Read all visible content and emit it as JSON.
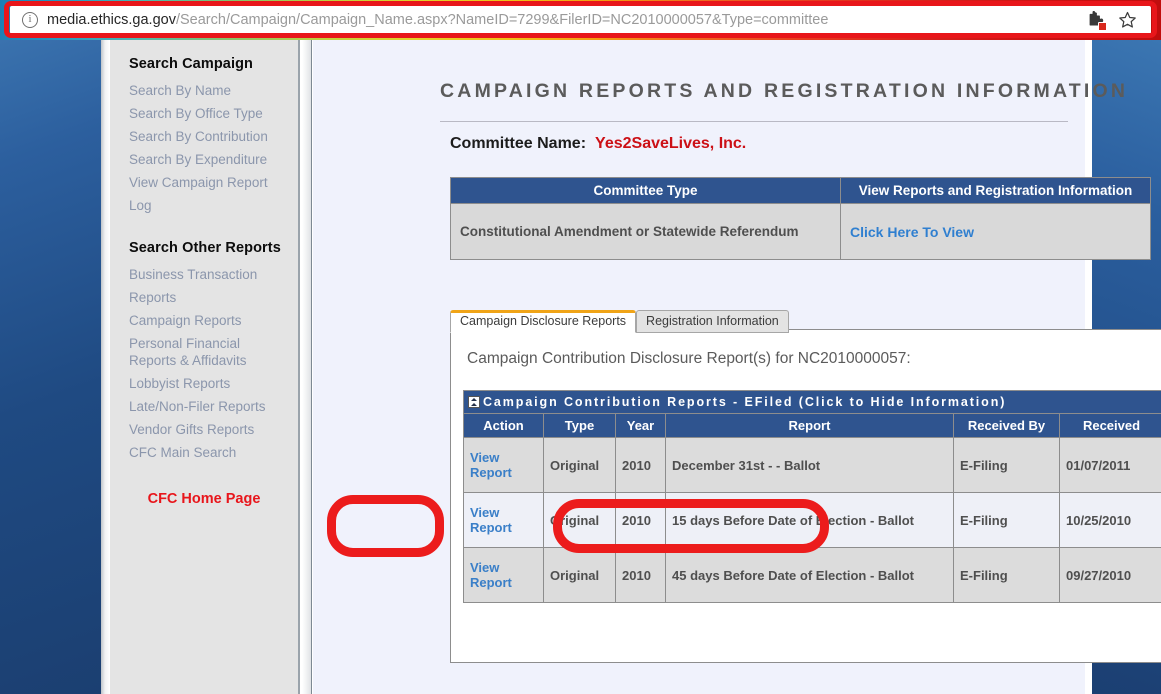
{
  "browser": {
    "url_host": "media.ethics.ga.gov",
    "url_path": "/Search/Campaign/Campaign_Name.aspx?NameID=7299&FilerID=NC2010000057&Type=committee",
    "info_icon": "info-icon",
    "blocked_content_icon": "puzzle-blocked-icon",
    "bookmark_icon": "star-icon",
    "accent_red": "#e8161a"
  },
  "sidebar": {
    "section_one_title": "Search Campaign",
    "section_one_links": [
      "Search By Name",
      "Search By Office Type",
      "Search By Contribution",
      "Search By Expenditure",
      "View Campaign Report Log"
    ],
    "section_two_title": "Search Other Reports",
    "section_two_links": [
      "Business Transaction Reports",
      "Campaign Reports",
      "Personal Financial Reports & Affidavits",
      "Lobbyist Reports",
      "Late/Non-Filer Reports",
      "Vendor Gifts Reports",
      "CFC Main Search"
    ],
    "home_link": "CFC Home Page",
    "home_link_color": "#e8151b"
  },
  "main": {
    "page_title": "CAMPAIGN REPORTS AND REGISTRATION INFORMATION",
    "committee_label": "Committee Name:",
    "committee_name": "Yes2SaveLives, Inc.",
    "committee_name_color": "#cc1016",
    "committee_table": {
      "headers": [
        "Committee Type",
        "View Reports and Registration Information"
      ],
      "row": {
        "type": "Constitutional Amendment or Statewide Referendum",
        "link": "Click Here To View"
      }
    },
    "tabs": [
      {
        "label": "Campaign Disclosure Reports",
        "active": true
      },
      {
        "label": "Registration Information",
        "active": false
      }
    ],
    "panel_caption": "Campaign Contribution Disclosure Report(s) for NC2010000057:",
    "reports_bar_title": "Campaign Contribution Reports - EFiled (Click to Hide Information)",
    "collapse_icon": "chevron-double-up-icon",
    "table_headers": [
      "Action",
      "Type",
      "Year",
      "Report",
      "Received By",
      "Received"
    ],
    "rows": [
      {
        "action": "View Report",
        "type": "Original",
        "year": "2010",
        "report": "December 31st - - Ballot",
        "received_by": "E-Filing",
        "received": "01/07/2011"
      },
      {
        "action": "View Report",
        "type": "Original",
        "year": "2010",
        "report": "15 days Before Date of Election - Ballot",
        "received_by": "E-Filing",
        "received": "10/25/2010"
      },
      {
        "action": "View Report",
        "type": "Original",
        "year": "2010",
        "report": "45 days Before Date of Election - Ballot",
        "received_by": "E-Filing",
        "received": "09/27/2010"
      }
    ]
  },
  "annotations": {
    "color": "#ec1c1c",
    "highlight_action": "View Report",
    "highlight_report": "15 days Before Date of Election - Ballot"
  }
}
